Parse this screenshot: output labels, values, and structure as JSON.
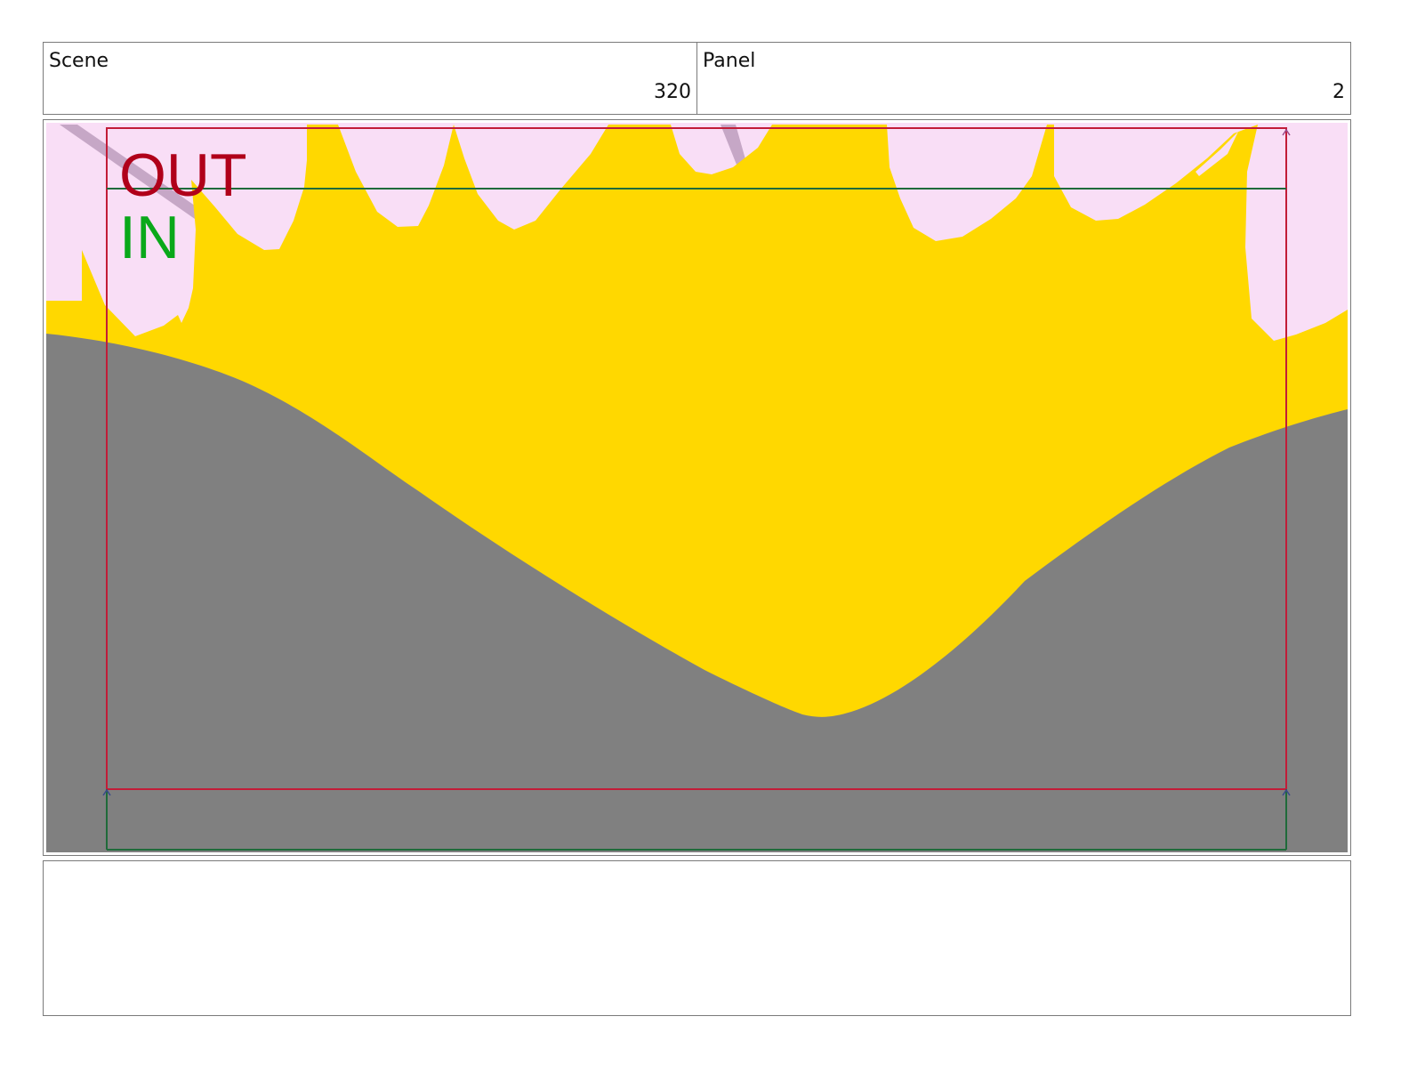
{
  "header": {
    "scene_label": "Scene",
    "scene_value": "320",
    "panel_label": "Panel",
    "panel_value": "2"
  },
  "frame": {
    "out_label": "OUT",
    "in_label": "IN",
    "colors": {
      "sky": "#f9def6",
      "flame": "#ffd800",
      "ground": "#808080",
      "branch": "#c6a7c6",
      "out_marker": "#b0001a",
      "in_marker": "#0aa81a",
      "in_frame_line": "#1f6b3a",
      "out_frame_line": "#c21c38"
    }
  },
  "notes": {
    "text": ""
  }
}
